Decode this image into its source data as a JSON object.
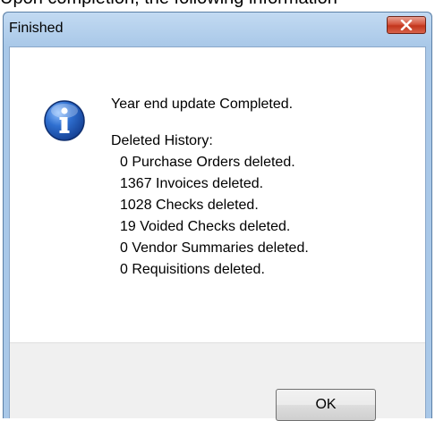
{
  "document": {
    "caption": "Upon completion, the following information"
  },
  "dialog": {
    "title": "Finished",
    "close_label": "X",
    "icon": "info-icon",
    "headline": "Year end update Completed.",
    "history_heading": "Deleted History:",
    "history_items": [
      "0 Purchase Orders deleted.",
      "1367 Invoices deleted.",
      "1028 Checks deleted.",
      "19 Voided Checks deleted.",
      "0 Vendor Summaries deleted.",
      "0 Requisitions deleted."
    ],
    "ok_label": "OK"
  },
  "colors": {
    "titlebar": "#a9c8e8",
    "close_button": "#c2351c",
    "info_icon": "#1e4fa8",
    "button_area": "#f0f0f0"
  }
}
